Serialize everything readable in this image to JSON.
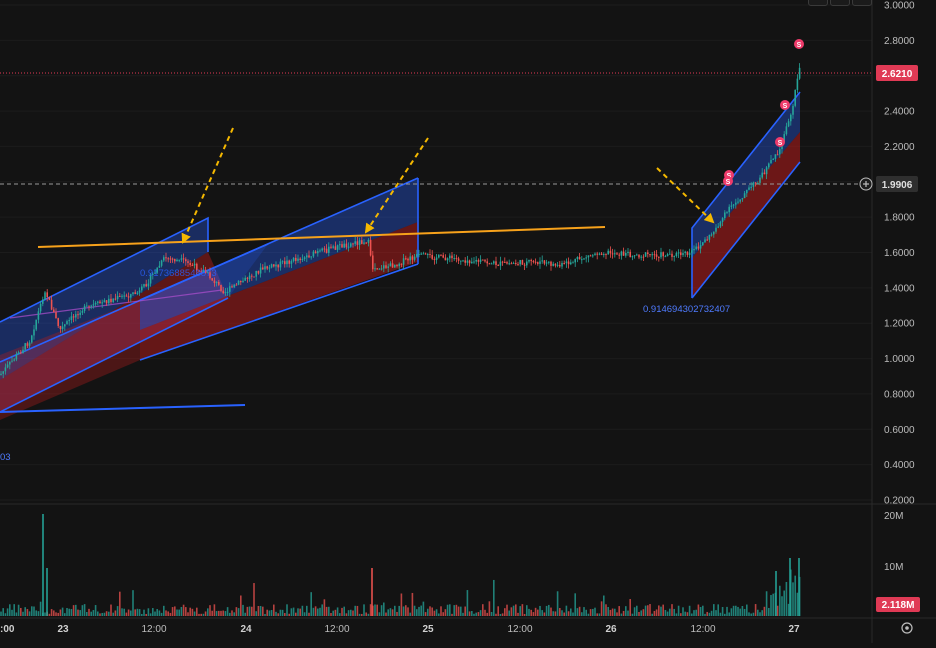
{
  "price_axis": {
    "ticks": [
      "3.0000",
      "2.8000",
      "2.6000",
      "2.4000",
      "2.2000",
      "2.0000",
      "1.8000",
      "1.6000",
      "1.4000",
      "1.2000",
      "1.0000",
      "0.8000",
      "0.6000",
      "0.4000",
      "0.2000"
    ],
    "tick_values": [
      3.0,
      2.8,
      2.6,
      2.4,
      2.2,
      2.0,
      1.8,
      1.6,
      1.4,
      1.2,
      1.0,
      0.8,
      0.6,
      0.4,
      0.2
    ],
    "last_price_label": "2.6210",
    "last_price_value": 2.621,
    "crosshair_label": "1.9906",
    "crosshair_value": 1.9906,
    "plus_icon": "plus-circle-icon"
  },
  "volume_axis": {
    "ticks": [
      "20M",
      "10M"
    ],
    "tick_values": [
      20,
      10
    ],
    "last_volume_label": "2.118M",
    "last_volume_value": 2.118
  },
  "time_axis": {
    "ticks": [
      ":00",
      "23",
      "12:00",
      "24",
      "12:00",
      "25",
      "12:00",
      "26",
      "12:00",
      "27"
    ],
    "settings_icon": "gear-icon"
  },
  "annotations": {
    "fib_label_left": "0.9173688548873",
    "fib_label_right": "0.914694302732407",
    "fib_label_edge": "03"
  },
  "signals": [
    "S",
    "S",
    "S",
    "S",
    "S"
  ],
  "colors": {
    "background": "#131313",
    "up_candle": "#26a69a",
    "down_candle": "#ef5350",
    "channel_blue": "#2962ff",
    "channel_red": "#b71c1c",
    "trendline_orange": "#f7a21b",
    "arrow_yellow": "#f5b800",
    "last_price_badge": "#e03a55",
    "sell_marker": "#ef3b6b"
  }
}
